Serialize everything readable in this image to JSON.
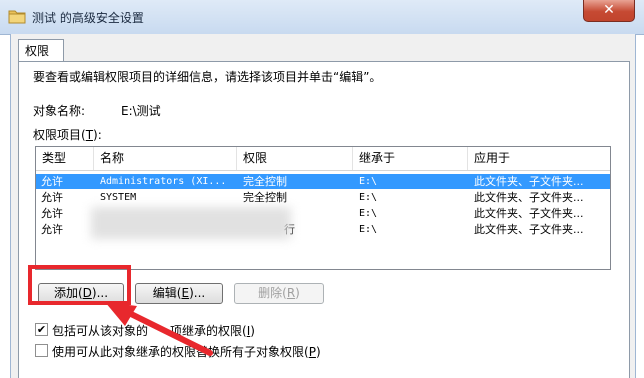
{
  "window": {
    "title": "测试 的高级安全设置",
    "close": "✕"
  },
  "tab": "权限",
  "description": "要查看或编辑权限项目的详细信息，请选择该项目并单击“编辑”。",
  "object": {
    "label": "对象名称:",
    "value": "E:\\测试"
  },
  "entries_label": "权限项目(",
  "entries_hotkey": "T",
  "entries_suffix": "):",
  "columns": [
    "类型",
    "名称",
    "权限",
    "继承于",
    "应用于"
  ],
  "rows": [
    {
      "type": "允许",
      "name": "Administrators (XI...",
      "permission": "完全控制",
      "inherited": "E:\\",
      "applies": "此文件夹、子文件夹..."
    },
    {
      "type": "允许",
      "name": "SYSTEM",
      "permission": "完全控制",
      "inherited": "E:\\",
      "applies": "此文件夹、子文件夹..."
    },
    {
      "type": "允许",
      "name": "",
      "permission": "",
      "inherited": "E:\\",
      "applies": "此文件夹、子文件夹..."
    },
    {
      "type": "允许",
      "name": "",
      "permission": "行",
      "inherited": "E:\\",
      "applies": "此文件夹、子文件夹..."
    }
  ],
  "buttons": {
    "add": {
      "label": "添加(",
      "key": "D",
      "suffix": ")..."
    },
    "edit": {
      "label": "编辑(",
      "key": "E",
      "suffix": ")..."
    },
    "remove": {
      "label": "删除(",
      "key": "R",
      "suffix": ")"
    }
  },
  "checkboxes": {
    "include_inheritable": {
      "label_a": "包括可从该对象的",
      "label_b": "项继承的权限(",
      "key": "I",
      "suffix": ")",
      "checked": true
    },
    "replace_child": {
      "label": "使用可从此对象继承的权限替换所有子对象权限(",
      "key": "P",
      "suffix": ")",
      "checked": false
    }
  },
  "colors": {
    "selection": "#3399ff",
    "annotation": "#e8282d"
  }
}
